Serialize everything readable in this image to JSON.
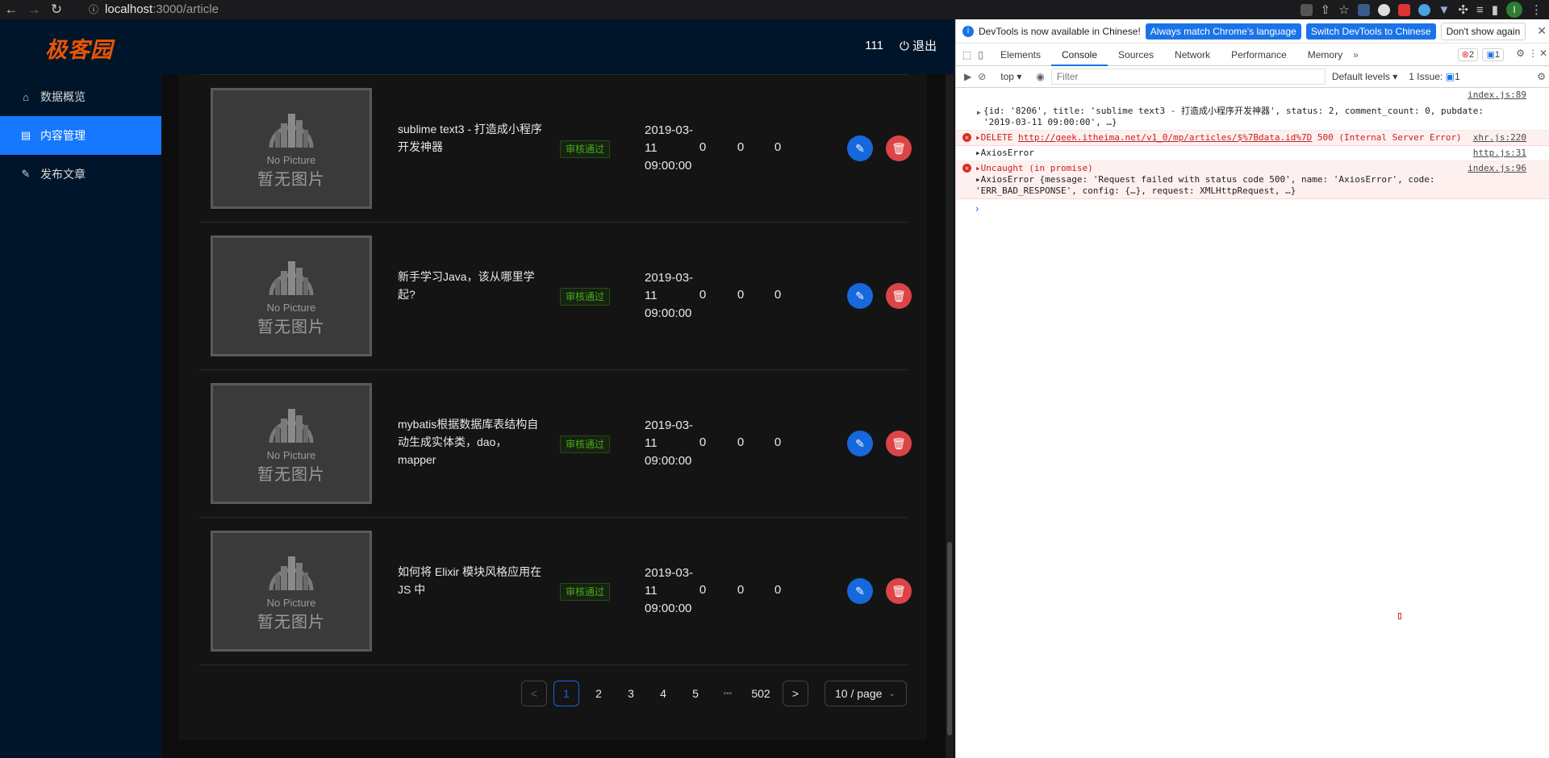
{
  "browser": {
    "url_host": "localhost",
    "url_path": ":3000/article"
  },
  "app": {
    "logo": "极客园",
    "user": "111",
    "logout": "退出",
    "menu": [
      {
        "label": "数据概览",
        "icon": "home-icon"
      },
      {
        "label": "内容管理",
        "icon": "file-icon",
        "active": true
      },
      {
        "label": "发布文章",
        "icon": "pencil-icon"
      }
    ],
    "no_picture_en": "No Picture",
    "no_picture_cn": "暂无图片",
    "rows": [
      {
        "title": "sublime text3 - 打造成小程序开发神器",
        "status": "审核通过",
        "date": "2019-03-11 09:00:00",
        "read": "0",
        "comment": "0",
        "like": "0"
      },
      {
        "title": "新手学习Java，该从哪里学起?",
        "status": "审核通过",
        "date": "2019-03-11 09:00:00",
        "read": "0",
        "comment": "0",
        "like": "0"
      },
      {
        "title": "mybatis根据数据库表结构自动生成实体类，dao，mapper",
        "status": "审核通过",
        "date": "2019-03-11 09:00:00",
        "read": "0",
        "comment": "0",
        "like": "0"
      },
      {
        "title": "如何将 Elixir 模块风格应用在 JS 中",
        "status": "审核通过",
        "date": "2019-03-11 09:00:00",
        "read": "0",
        "comment": "0",
        "like": "0"
      }
    ],
    "pagination": {
      "prev": "<",
      "pages": [
        "1",
        "2",
        "3",
        "4",
        "5"
      ],
      "ellipsis": "•••",
      "last": "502",
      "next": ">",
      "size": "10 / page"
    }
  },
  "devtools": {
    "banner": {
      "text": "DevTools is now available in Chinese!",
      "btn1": "Always match Chrome's language",
      "btn2": "Switch DevTools to Chinese",
      "btn3": "Don't show again"
    },
    "tabs": [
      "Elements",
      "Console",
      "Sources",
      "Network",
      "Performance",
      "Memory"
    ],
    "errors_count": "2",
    "messages_count": "1",
    "context": "top",
    "filter_placeholder": "Filter",
    "levels": "Default levels",
    "issues": "1 Issue:",
    "issues_count": "1",
    "console": {
      "l1_src": "index.js:89",
      "l1_text": "{id: '8206', title: 'sublime text3 - 打造成小程序开发神器', status: 2, comment_count: 0, pubdate: '2019-03-11 09:00:00', …}",
      "l2_src": "xhr.js:220",
      "l2_method": "DELETE",
      "l2_url": "http://geek.itheima.net/v1_0/mp/articles/$%7Bdata.id%7D",
      "l2_status": "500 (Internal Server Error)",
      "l3_src": "http.js:31",
      "l3_text": "AxiosError",
      "l4_src": "index.js:96",
      "l4_head": "Uncaught (in promise)",
      "l4_text": "AxiosError {message: 'Request failed with status code 500', name: 'AxiosError', code: 'ERR_BAD_RESPONSE', config: {…}, request: XMLHttpRequest, …}"
    }
  }
}
